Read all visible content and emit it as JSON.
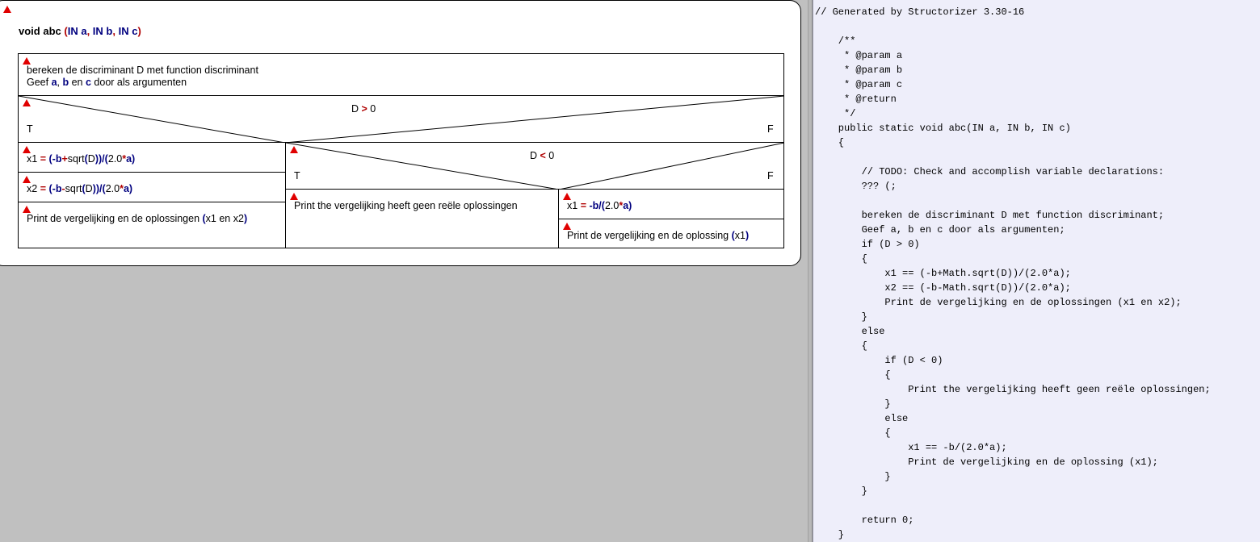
{
  "diagram": {
    "title": {
      "prefix": "void abc ",
      "paren_open": "(",
      "in1": "IN ",
      "a": "a",
      "sep1": ", ",
      "in2": "IN ",
      "b": "b",
      "sep2": ", ",
      "in3": "IN ",
      "c": "c",
      "paren_close": ")"
    },
    "instruction1": {
      "line1": "bereken de discriminant D met function discriminant",
      "line2_prefix": "Geef ",
      "a": "a",
      "comma": ", ",
      "b": "b",
      "en": " en ",
      "c": "c",
      "suffix": " door als argumenten"
    },
    "if_outer": {
      "cond_left": "D ",
      "cond_op": ">",
      "cond_right": " 0",
      "true_label": "T",
      "false_label": "F"
    },
    "x1_assign": {
      "lhs": "x1 ",
      "eq": "=",
      "sp": " ",
      "lp": "(",
      "neg": "-",
      "b": "b",
      "plus": "+",
      "fn": "sqrt",
      "lp2": "(",
      "arg": "D",
      "rp2": ")",
      "rp": ")",
      "div": "/",
      "lp3": "(",
      "num": "2.0",
      "mul": "*",
      "a": "a",
      "rp3": ")"
    },
    "x2_assign": {
      "lhs": "x2 ",
      "eq": "=",
      "sp": " ",
      "lp": "(",
      "neg": "-",
      "b": "b",
      "minus": "-",
      "fn": "sqrt",
      "lp2": "(",
      "arg": "D",
      "rp2": ")",
      "rp": ")",
      "div": "/",
      "lp3": "(",
      "num": "2.0",
      "mul": "*",
      "a": "a",
      "rp3": ")"
    },
    "print_two": {
      "text": "Print de vergelijking en de oplossingen ",
      "lp": "(",
      "mid": "x1 en x2",
      "rp": ")"
    },
    "if_inner": {
      "cond_left": "D ",
      "cond_op": "<",
      "cond_right": " 0",
      "true_label": "T",
      "false_label": "F"
    },
    "print_none": "Print the vergelijking heeft geen reële oplossingen",
    "x1_single": {
      "lhs": "x1 ",
      "eq": "=",
      "sp": " ",
      "neg": "-",
      "b": "b",
      "div": "/",
      "lp": "(",
      "num": "2.0",
      "mul": "*",
      "a": "a",
      "rp": ")"
    },
    "print_one": {
      "text": "Print de vergelijking en de oplossing ",
      "lp": "(",
      "mid": "x1",
      "rp": ")"
    }
  },
  "code": {
    "lines": [
      "// Generated by Structorizer 3.30-16",
      "",
      "    /**",
      "     * @param a",
      "     * @param b",
      "     * @param c",
      "     * @return",
      "     */",
      "    public static void abc(IN a, IN b, IN c)",
      "    {",
      "",
      "        // TODO: Check and accomplish variable declarations:",
      "        ??? (;",
      "",
      "        bereken de discriminant D met function discriminant;",
      "        Geef a, b en c door als argumenten;",
      "        if (D > 0)",
      "        {",
      "            x1 == (-b+Math.sqrt(D))/(2.0*a);",
      "            x2 == (-b-Math.sqrt(D))/(2.0*a);",
      "            Print de vergelijking en de oplossingen (x1 en x2);",
      "        }",
      "        else",
      "        {",
      "            if (D < 0)",
      "            {",
      "                Print the vergelijking heeft geen reële oplossingen;",
      "            }",
      "            else",
      "            {",
      "                x1 == -b/(2.0*a);",
      "                Print de vergelijking en de oplossing (x1);",
      "            }",
      "        }",
      "",
      "        return 0;",
      "    }"
    ]
  },
  "colors": {
    "background": "#c0c0c0",
    "code_background": "#eeeefa",
    "keyword_blue": "#00007f",
    "operator_red": "#b00000",
    "marker_red": "#e00000"
  }
}
